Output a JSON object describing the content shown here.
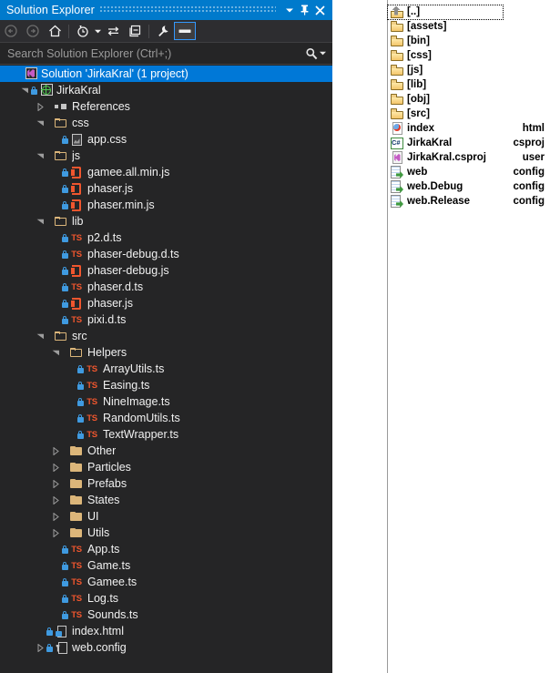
{
  "solution_explorer": {
    "title": "Solution Explorer",
    "titlebar_buttons": [
      {
        "name": "window-menu-dropdown",
        "glyph": "chevron-down-icon"
      },
      {
        "name": "pin-button",
        "glyph": "pin-icon"
      },
      {
        "name": "close-button",
        "glyph": "close-icon"
      }
    ],
    "toolbar": [
      {
        "name": "back-button",
        "icon": "back-arrow-icon",
        "state": "disabled"
      },
      {
        "name": "forward-button",
        "icon": "forward-arrow-icon",
        "state": "disabled"
      },
      {
        "name": "home-button",
        "icon": "home-icon",
        "state": "enabled"
      },
      {
        "name": "pending-changes-button",
        "icon": "clock-icon",
        "state": "enabled"
      },
      {
        "name": "pending-changes-dropdown",
        "icon": "chevron-down-icon",
        "state": "enabled"
      },
      {
        "name": "sync-with-active-document-button",
        "icon": "sync-arrows-icon",
        "state": "enabled"
      },
      {
        "name": "collapse-all-button",
        "icon": "collapse-all-icon",
        "state": "enabled"
      },
      {
        "name": "properties-button",
        "icon": "wrench-icon",
        "state": "enabled"
      },
      {
        "name": "preview-selected-items-button",
        "icon": "preview-pane-icon",
        "state": "selected"
      }
    ],
    "search": {
      "placeholder": "Search Solution Explorer (Ctrl+;)",
      "icon": "search-icon",
      "dropdown_icon": "chevron-down-icon"
    },
    "tree": [
      {
        "label": "Solution 'JirkaKral' (1 project)",
        "indent": 0,
        "expander": "none",
        "icon": "solution",
        "lock": false,
        "selected": true
      },
      {
        "label": "JirkaKral",
        "indent": 1,
        "expander": "open",
        "icon": "project",
        "lock": true,
        "selected": false
      },
      {
        "label": "References",
        "indent": 2,
        "expander": "closed",
        "icon": "references",
        "lock": false,
        "selected": false
      },
      {
        "label": "css",
        "indent": 2,
        "expander": "open",
        "icon": "folder-open",
        "lock": false,
        "selected": false
      },
      {
        "label": "app.css",
        "indent": 3,
        "expander": "none",
        "icon": "css-doc",
        "lock": true,
        "selected": false
      },
      {
        "label": "js",
        "indent": 2,
        "expander": "open",
        "icon": "folder-open",
        "lock": false,
        "selected": false
      },
      {
        "label": "gamee.all.min.js",
        "indent": 3,
        "expander": "none",
        "icon": "js",
        "lock": true,
        "selected": false
      },
      {
        "label": "phaser.js",
        "indent": 3,
        "expander": "none",
        "icon": "js",
        "lock": true,
        "selected": false
      },
      {
        "label": "phaser.min.js",
        "indent": 3,
        "expander": "none",
        "icon": "js",
        "lock": true,
        "selected": false
      },
      {
        "label": "lib",
        "indent": 2,
        "expander": "open",
        "icon": "folder-open",
        "lock": false,
        "selected": false
      },
      {
        "label": "p2.d.ts",
        "indent": 3,
        "expander": "none",
        "icon": "ts",
        "lock": true,
        "selected": false
      },
      {
        "label": "phaser-debug.d.ts",
        "indent": 3,
        "expander": "none",
        "icon": "ts",
        "lock": true,
        "selected": false
      },
      {
        "label": "phaser-debug.js",
        "indent": 3,
        "expander": "none",
        "icon": "js",
        "lock": true,
        "selected": false
      },
      {
        "label": "phaser.d.ts",
        "indent": 3,
        "expander": "none",
        "icon": "ts",
        "lock": true,
        "selected": false
      },
      {
        "label": "phaser.js",
        "indent": 3,
        "expander": "none",
        "icon": "js",
        "lock": true,
        "selected": false
      },
      {
        "label": "pixi.d.ts",
        "indent": 3,
        "expander": "none",
        "icon": "ts",
        "lock": true,
        "selected": false
      },
      {
        "label": "src",
        "indent": 2,
        "expander": "open",
        "icon": "folder-open",
        "lock": false,
        "selected": false
      },
      {
        "label": "Helpers",
        "indent": 3,
        "expander": "open",
        "icon": "folder-open",
        "lock": false,
        "selected": false
      },
      {
        "label": "ArrayUtils.ts",
        "indent": 4,
        "expander": "none",
        "icon": "ts",
        "lock": true,
        "selected": false
      },
      {
        "label": "Easing.ts",
        "indent": 4,
        "expander": "none",
        "icon": "ts",
        "lock": true,
        "selected": false
      },
      {
        "label": "NineImage.ts",
        "indent": 4,
        "expander": "none",
        "icon": "ts",
        "lock": true,
        "selected": false
      },
      {
        "label": "RandomUtils.ts",
        "indent": 4,
        "expander": "none",
        "icon": "ts",
        "lock": true,
        "selected": false
      },
      {
        "label": "TextWrapper.ts",
        "indent": 4,
        "expander": "none",
        "icon": "ts",
        "lock": true,
        "selected": false
      },
      {
        "label": "Other",
        "indent": 3,
        "expander": "closed",
        "icon": "folder-closed",
        "lock": false,
        "selected": false
      },
      {
        "label": "Particles",
        "indent": 3,
        "expander": "closed",
        "icon": "folder-closed",
        "lock": false,
        "selected": false
      },
      {
        "label": "Prefabs",
        "indent": 3,
        "expander": "closed",
        "icon": "folder-closed",
        "lock": false,
        "selected": false
      },
      {
        "label": "States",
        "indent": 3,
        "expander": "closed",
        "icon": "folder-closed",
        "lock": false,
        "selected": false
      },
      {
        "label": "UI",
        "indent": 3,
        "expander": "closed",
        "icon": "folder-closed",
        "lock": false,
        "selected": false
      },
      {
        "label": "Utils",
        "indent": 3,
        "expander": "closed",
        "icon": "folder-closed",
        "lock": false,
        "selected": false
      },
      {
        "label": "App.ts",
        "indent": 3,
        "expander": "none",
        "icon": "ts",
        "lock": true,
        "selected": false
      },
      {
        "label": "Game.ts",
        "indent": 3,
        "expander": "none",
        "icon": "ts",
        "lock": true,
        "selected": false
      },
      {
        "label": "Gamee.ts",
        "indent": 3,
        "expander": "none",
        "icon": "ts",
        "lock": true,
        "selected": false
      },
      {
        "label": "Log.ts",
        "indent": 3,
        "expander": "none",
        "icon": "ts",
        "lock": true,
        "selected": false
      },
      {
        "label": "Sounds.ts",
        "indent": 3,
        "expander": "none",
        "icon": "ts",
        "lock": true,
        "selected": false
      },
      {
        "label": "index.html",
        "indent": 2,
        "expander": "none",
        "icon": "html",
        "lock": true,
        "selected": false
      },
      {
        "label": "web.config",
        "indent": 2,
        "expander": "closed",
        "icon": "config",
        "lock": true,
        "selected": false
      }
    ]
  },
  "file_list": {
    "rows": [
      {
        "name": "[..]",
        "ext": "",
        "icon": "up-folder",
        "focused": true
      },
      {
        "name": "[assets]",
        "ext": "",
        "icon": "folder",
        "focused": false
      },
      {
        "name": "[bin]",
        "ext": "",
        "icon": "folder",
        "focused": false
      },
      {
        "name": "[css]",
        "ext": "",
        "icon": "folder",
        "focused": false
      },
      {
        "name": "[js]",
        "ext": "",
        "icon": "folder",
        "focused": false
      },
      {
        "name": "[lib]",
        "ext": "",
        "icon": "folder",
        "focused": false
      },
      {
        "name": "[obj]",
        "ext": "",
        "icon": "folder",
        "focused": false
      },
      {
        "name": "[src]",
        "ext": "",
        "icon": "folder",
        "focused": false
      },
      {
        "name": "index",
        "ext": "html",
        "icon": "html-doc",
        "focused": false
      },
      {
        "name": "JirkaKral",
        "ext": "csproj",
        "icon": "csharp-project",
        "focused": false
      },
      {
        "name": "JirkaKral.csproj",
        "ext": "user",
        "icon": "vs-user-file",
        "focused": false
      },
      {
        "name": "web",
        "ext": "config",
        "icon": "config-doc",
        "focused": false
      },
      {
        "name": "web.Debug",
        "ext": "config",
        "icon": "config-doc",
        "focused": false
      },
      {
        "name": "web.Release",
        "ext": "config",
        "icon": "config-doc",
        "focused": false
      }
    ]
  },
  "colors": {
    "titlebar": "#007acc",
    "panel_bg": "#252526",
    "toolbar_bg": "#2d2d30",
    "selection": "#0078d7",
    "text": "#f1f1f1",
    "folder": "#dcb67a",
    "typescript": "#f0562e",
    "lock": "#3f9ae0"
  }
}
